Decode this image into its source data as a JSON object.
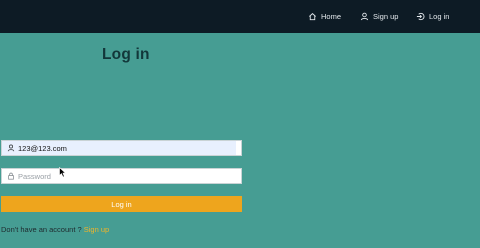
{
  "nav": {
    "home": "Home",
    "signup": "Sign up",
    "login": "Log in"
  },
  "page": {
    "title": "Log in"
  },
  "form": {
    "email_value": "123@123.com",
    "password_placeholder": "Password",
    "submit_label": "Log in"
  },
  "footer": {
    "prompt": "Don't have an account ?",
    "signup_link": "Sign up"
  },
  "colors": {
    "background": "#469d93",
    "navbar": "#0d1b25",
    "button": "#eea51d",
    "link": "#f0b429"
  },
  "icons": [
    "home-icon",
    "user-icon",
    "login-icon",
    "user-field-icon",
    "lock-icon",
    "mouse-cursor-icon"
  ]
}
